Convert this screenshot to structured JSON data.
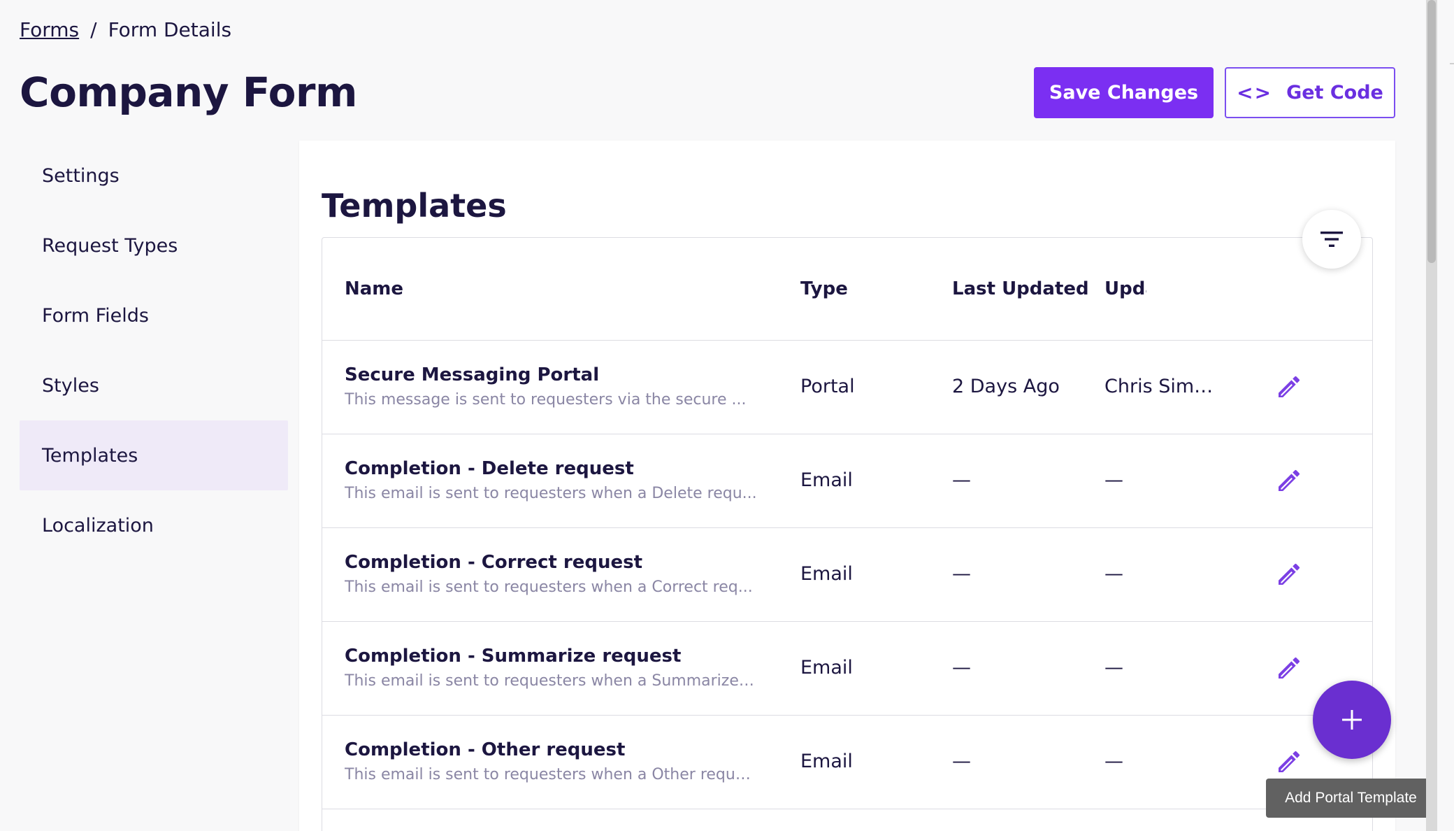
{
  "breadcrumb": {
    "parent": "Forms",
    "separator": "/",
    "current": "Form Details"
  },
  "page": {
    "title": "Company Form"
  },
  "actions": {
    "save_label": "Save Changes",
    "code_label": "Get Code",
    "code_icon_glyph": "<>"
  },
  "sidebar": {
    "items": [
      {
        "label": "Settings",
        "active": false
      },
      {
        "label": "Request Types",
        "active": false
      },
      {
        "label": "Form Fields",
        "active": false
      },
      {
        "label": "Styles",
        "active": false
      },
      {
        "label": "Templates",
        "active": true
      },
      {
        "label": "Localization",
        "active": false
      }
    ]
  },
  "templates": {
    "title": "Templates",
    "columns": {
      "name": "Name",
      "type": "Type",
      "last_updated": "Last Updated",
      "updated_by": "Updated By"
    },
    "rows": [
      {
        "name": "Secure Messaging Portal",
        "description": "This message is sent to requesters via the secure ...",
        "type": "Portal",
        "last_updated": "2 Days Ago",
        "updated_by": "Chris Simp..."
      },
      {
        "name": "Completion - Delete request",
        "description": "This email is sent to requesters when a Delete requ...",
        "type": "Email",
        "last_updated": "—",
        "updated_by": "—"
      },
      {
        "name": "Completion - Correct request",
        "description": "This email is sent to requesters when a Correct req...",
        "type": "Email",
        "last_updated": "—",
        "updated_by": "—"
      },
      {
        "name": "Completion - Summarize request",
        "description": "This email is sent to requesters when a Summarize ...",
        "type": "Email",
        "last_updated": "—",
        "updated_by": "—"
      },
      {
        "name": "Completion - Other request",
        "description": "This email is sent to requesters when a Other reque...",
        "type": "Email",
        "last_updated": "—",
        "updated_by": "—"
      }
    ]
  },
  "icons": {
    "filter": "filter-icon",
    "edit": "pencil-icon",
    "add": "plus-icon",
    "code": "code-icon"
  },
  "fab": {
    "tooltip": "Add Portal Template"
  },
  "colors": {
    "accent": "#7b2ff2",
    "fab": "#6a2fd0",
    "active_nav": "#efeaf8",
    "text": "#1c1640",
    "muted": "#8a86a4"
  }
}
